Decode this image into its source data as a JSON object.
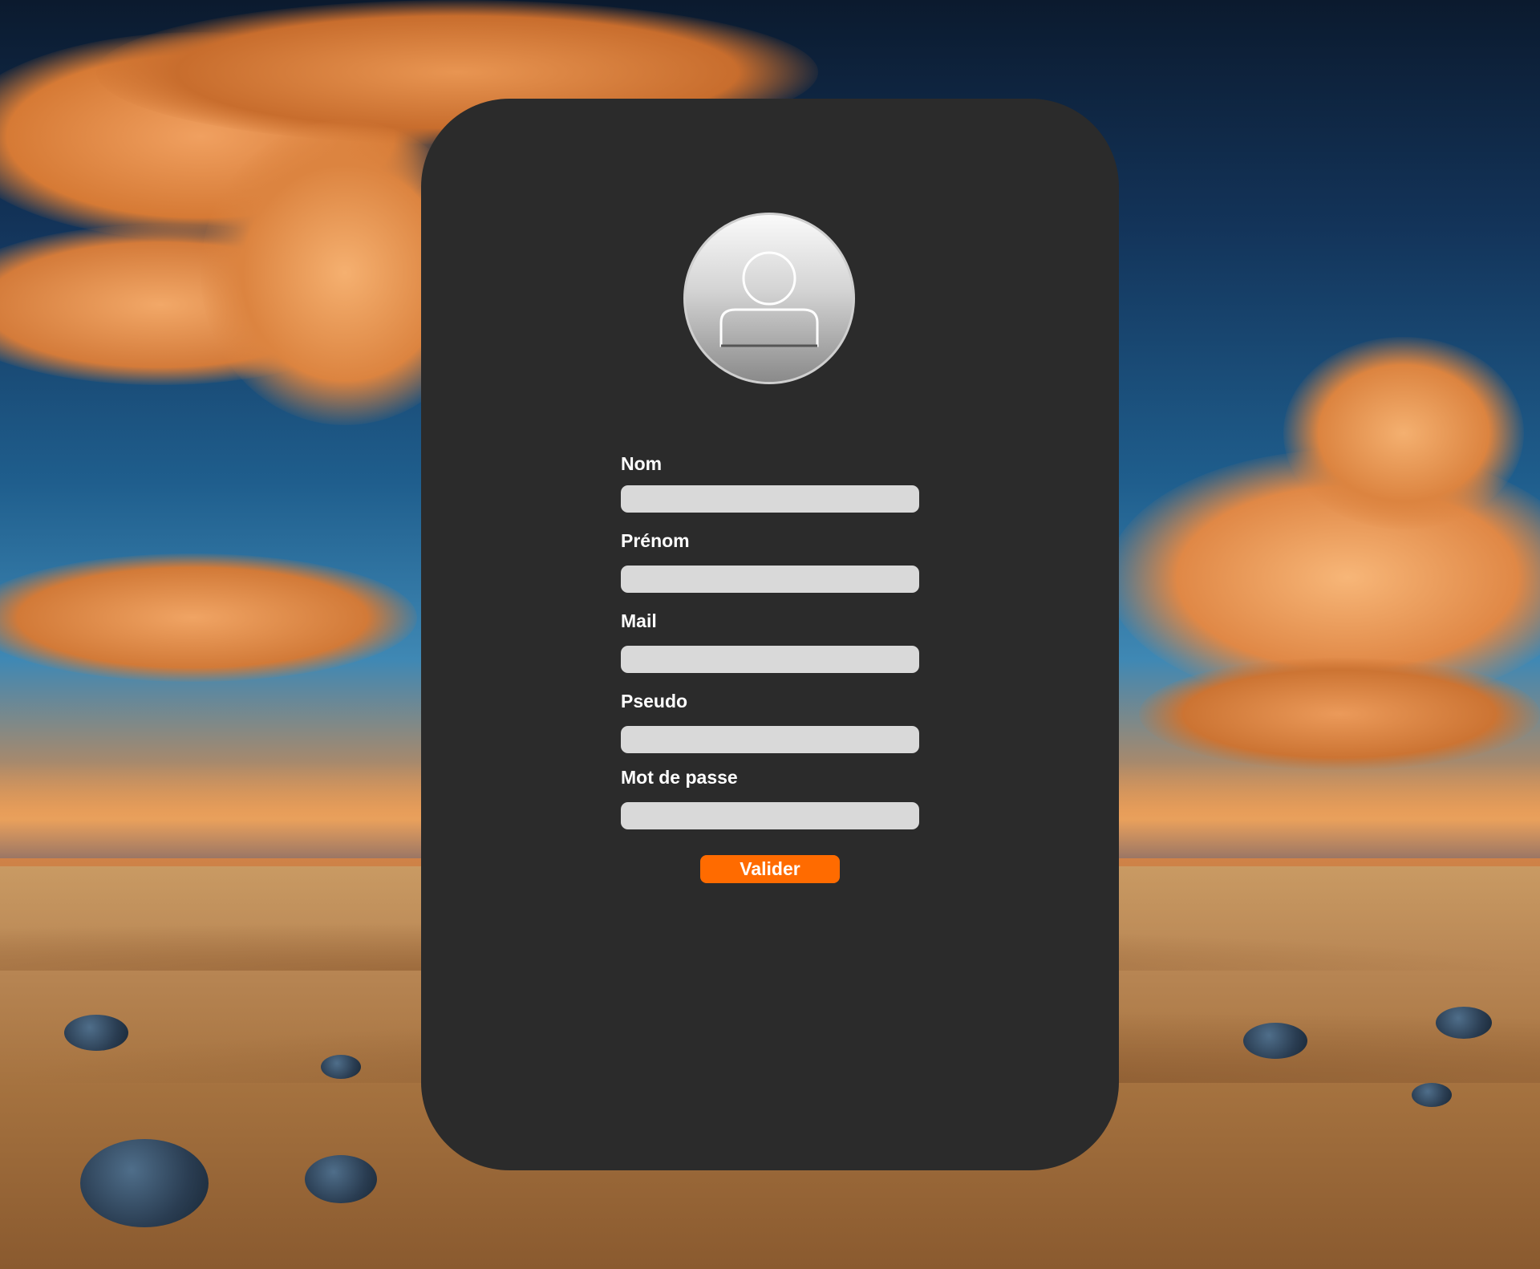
{
  "form": {
    "fields": [
      {
        "label": "Nom",
        "value": "",
        "placeholder": ""
      },
      {
        "label": "Prénom",
        "value": "",
        "placeholder": ""
      },
      {
        "label": "Mail",
        "value": "",
        "placeholder": ""
      },
      {
        "label": "Pseudo",
        "value": "",
        "placeholder": ""
      },
      {
        "label": "Mot de passe",
        "value": "",
        "placeholder": ""
      }
    ],
    "submit_label": "Valider"
  },
  "avatar": {
    "icon": "user-avatar-icon"
  },
  "colors": {
    "card": "#2b2b2b",
    "input": "#d9d9d9",
    "accent": "#ff6b00",
    "text": "#ffffff"
  }
}
